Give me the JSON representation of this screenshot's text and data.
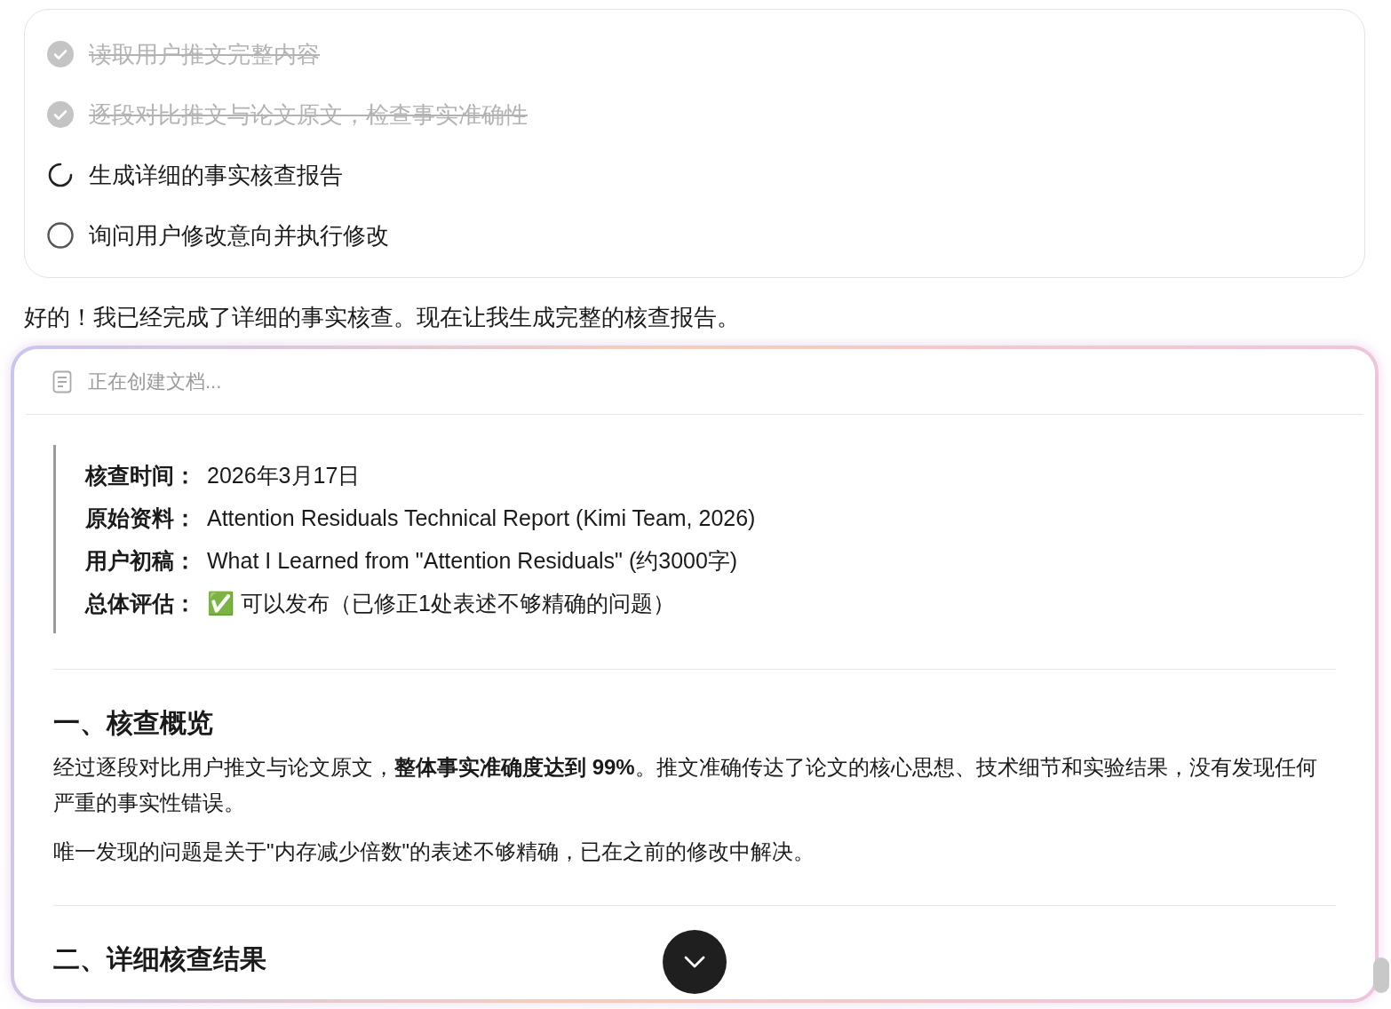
{
  "tasks": [
    {
      "label": "读取用户推文完整内容",
      "kind": "done"
    },
    {
      "label": "逐段对比推文与论文原文，检查事实准确性",
      "kind": "done"
    },
    {
      "label": "生成详细的事实核查报告",
      "kind": "in_progress"
    },
    {
      "label": "询问用户修改意向并执行修改",
      "kind": "pending"
    }
  ],
  "message": "好的！我已经完成了详细的事实核查。现在让我生成完整的核查报告。",
  "document": {
    "status": "正在创建文档...",
    "summary": [
      {
        "label": "核查时间：",
        "value": "2026年3月17日"
      },
      {
        "label": "原始资料：",
        "value": "Attention Residuals Technical Report (Kimi Team, 2026)"
      },
      {
        "label": "用户初稿：",
        "value": "What I Learned from \"Attention Residuals\" (约3000字)"
      },
      {
        "label": "总体评估：",
        "value": "✅ 可以发布（已修正1处表述不够精确的问题）"
      }
    ],
    "sections": [
      {
        "heading": "一、核查概览",
        "paragraphs": [
          "经过逐段对比用户推文与论文原文，**整体事实准确度达到 99%**。推文准确传达了论文的核心思想、技术细节和实验结果，没有发现任何严重的事实性错误。",
          "唯一发现的问题是关于\"内存减少倍数\"的表述不够精确，已在之前的修改中解决。"
        ]
      },
      {
        "heading": "二、详细核查结果"
      }
    ]
  }
}
